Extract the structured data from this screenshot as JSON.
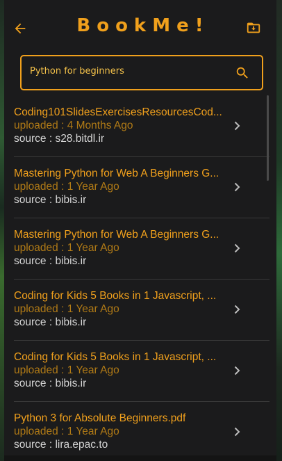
{
  "app": {
    "title": "BookMe!",
    "accent": "#f0a01c"
  },
  "header": {
    "back_icon": "arrow-left-icon",
    "download_icon": "folder-download-icon"
  },
  "search": {
    "value": "Python for beginners",
    "icon": "search-icon"
  },
  "results": [
    {
      "title": "Coding101SlidesExercisesResourcesCod...",
      "uploaded": "uploaded : 4 Months Ago",
      "source": "source : s28.bitdl.ir"
    },
    {
      "title": "Mastering Python for Web A Beginners G...",
      "uploaded": "uploaded : 1 Year Ago",
      "source": "source : bibis.ir"
    },
    {
      "title": "Mastering Python for Web A Beginners G...",
      "uploaded": "uploaded : 1 Year Ago",
      "source": "source : bibis.ir"
    },
    {
      "title": "Coding for Kids 5 Books in 1 Javascript, ...",
      "uploaded": "uploaded : 1 Year Ago",
      "source": "source : bibis.ir"
    },
    {
      "title": "Coding for Kids 5 Books in 1 Javascript, ...",
      "uploaded": "uploaded : 1 Year Ago",
      "source": "source : bibis.ir"
    },
    {
      "title": "Python 3 for Absolute Beginners.pdf",
      "uploaded": "uploaded : 1 Year Ago",
      "source": "source : lira.epac.to"
    }
  ]
}
